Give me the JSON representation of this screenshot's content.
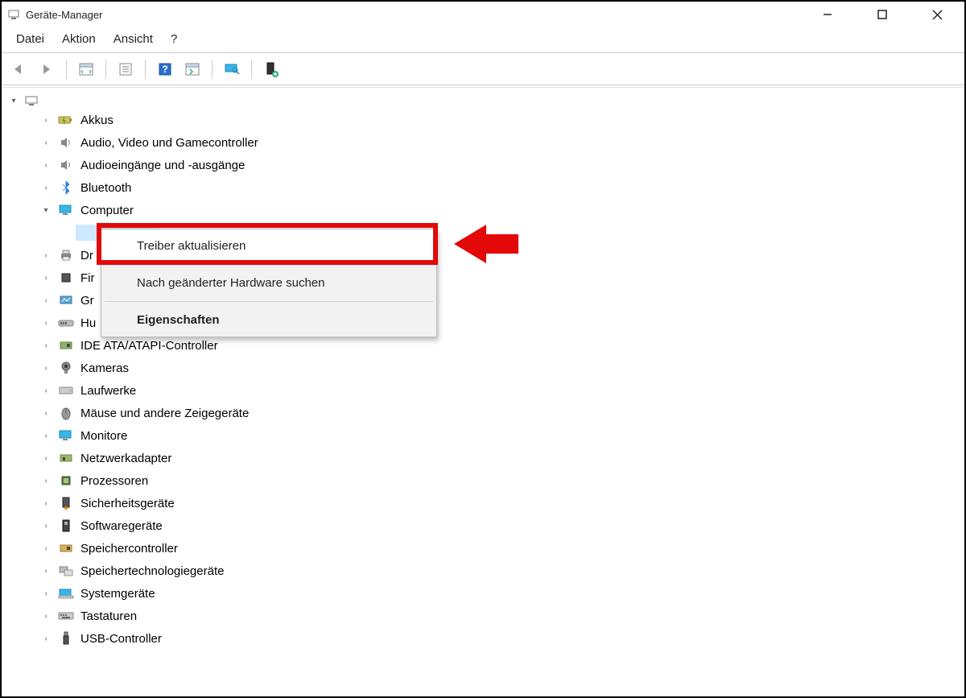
{
  "window": {
    "title": "Geräte-Manager"
  },
  "menu": {
    "datei": "Datei",
    "aktion": "Aktion",
    "ansicht": "Ansicht",
    "help": "?"
  },
  "tree": {
    "items": [
      {
        "label": "Akkus"
      },
      {
        "label": "Audio, Video und Gamecontroller"
      },
      {
        "label": "Audioeingänge und -ausgänge"
      },
      {
        "label": "Bluetooth"
      },
      {
        "label": "Computer"
      },
      {
        "label": "Dr"
      },
      {
        "label": "Fir"
      },
      {
        "label": "Gr"
      },
      {
        "label": "Hu"
      },
      {
        "label": "IDE ATA/ATAPI-Controller"
      },
      {
        "label": "Kameras"
      },
      {
        "label": "Laufwerke"
      },
      {
        "label": "Mäuse und andere Zeigegeräte"
      },
      {
        "label": "Monitore"
      },
      {
        "label": "Netzwerkadapter"
      },
      {
        "label": "Prozessoren"
      },
      {
        "label": "Sicherheitsgeräte"
      },
      {
        "label": "Softwaregeräte"
      },
      {
        "label": "Speichercontroller"
      },
      {
        "label": "Speichertechnologiegeräte"
      },
      {
        "label": "Systemgeräte"
      },
      {
        "label": "Tastaturen"
      },
      {
        "label": "USB-Controller"
      }
    ]
  },
  "contextmenu": {
    "update": "Treiber aktualisieren",
    "scan": "Nach geänderter Hardware suchen",
    "props": "Eigenschaften"
  }
}
